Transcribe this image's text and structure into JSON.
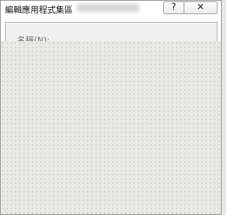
{
  "window": {
    "title": "編輯應用程式集區"
  },
  "titlebar_buttons": {
    "help_label": "?",
    "close_label": "✕"
  },
  "form": {
    "name_label": "名稱(N):"
  }
}
